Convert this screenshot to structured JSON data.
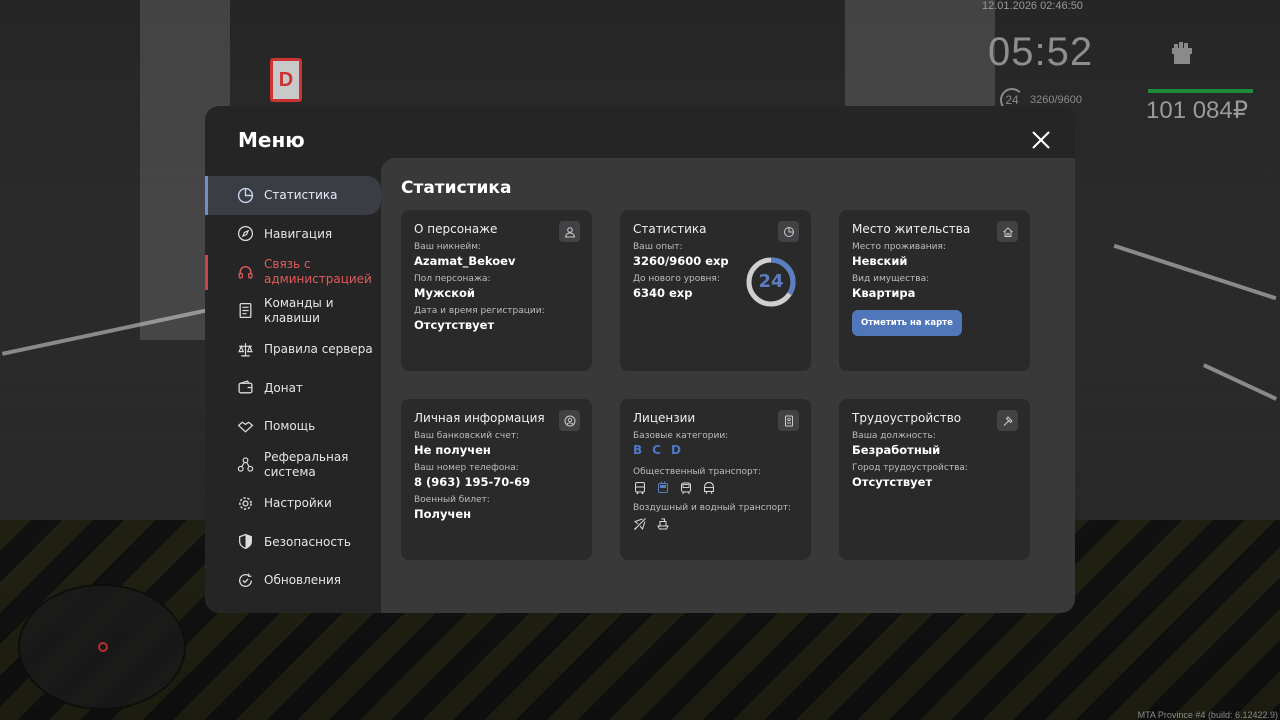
{
  "hud": {
    "datetime": "12.01.2026 02:46:50",
    "clock": "05:52",
    "level": "24",
    "xp": "3260/9600",
    "money": "101 084₽",
    "build": "MTA Province #4 (build: 6.12422.9)",
    "sign_letter": "D"
  },
  "menu": {
    "title": "Меню",
    "sidebar": [
      {
        "label": "Статистика",
        "icon": "chart-pie-icon",
        "state": "active"
      },
      {
        "label": "Навигация",
        "icon": "compass-icon",
        "state": ""
      },
      {
        "label": "Связь с администрацией",
        "icon": "headset-icon",
        "state": "alert"
      },
      {
        "label": "Команды и клавиши",
        "icon": "list-icon",
        "state": ""
      },
      {
        "label": "Правила сервера",
        "icon": "scales-icon",
        "state": ""
      },
      {
        "label": "Донат",
        "icon": "wallet-icon",
        "state": ""
      },
      {
        "label": "Помощь",
        "icon": "handshake-icon",
        "state": ""
      },
      {
        "label": "Реферальная система",
        "icon": "network-icon",
        "state": ""
      },
      {
        "label": "Настройки",
        "icon": "gear-icon",
        "state": ""
      },
      {
        "label": "Безопасность",
        "icon": "shield-icon",
        "state": ""
      },
      {
        "label": "Обновления",
        "icon": "refresh-check-icon",
        "state": ""
      }
    ]
  },
  "content": {
    "title": "Статистика",
    "character": {
      "title": "О персонаже",
      "nick_label": "Ваш никнейм:",
      "nick": "Azamat_Bekoev",
      "gender_label": "Пол персонажа:",
      "gender": "Мужской",
      "reg_label": "Дата и время регистрации:",
      "reg": "Отсутствует"
    },
    "stats": {
      "title": "Статистика",
      "exp_label": "Ваш опыт:",
      "exp": "3260/9600 exp",
      "next_label": "До нового уровня:",
      "next": "6340 exp",
      "level": "24",
      "progress": 0.34
    },
    "residence": {
      "title": "Место жительства",
      "place_label": "Место проживания:",
      "place": "Невский",
      "type_label": "Вид имущества:",
      "type": "Квартира",
      "button": "Отметить на карте"
    },
    "personal": {
      "title": "Личная информация",
      "bank_label": "Ваш банковский счет:",
      "bank": "Не получен",
      "phone_label": "Ваш номер телефона:",
      "phone": "8 (963) 195-70-69",
      "military_label": "Военный билет:",
      "military": "Получен"
    },
    "licenses": {
      "title": "Лицензии",
      "base_label": "Базовые категории:",
      "categories": [
        "B",
        "C",
        "D"
      ],
      "public_label": "Общественный транспорт:",
      "public_icons": [
        "bus-icon",
        "trolleybus-icon",
        "tram-icon",
        "metro-icon"
      ],
      "air_label": "Воздушный и водный транспорт:",
      "air_icons": [
        "plane-icon",
        "boat-icon"
      ]
    },
    "job": {
      "title": "Трудоустройство",
      "position_label": "Ваша должность:",
      "position": "Безработный",
      "city_label": "Город трудоустройства:",
      "city": "Отсутствует"
    }
  }
}
